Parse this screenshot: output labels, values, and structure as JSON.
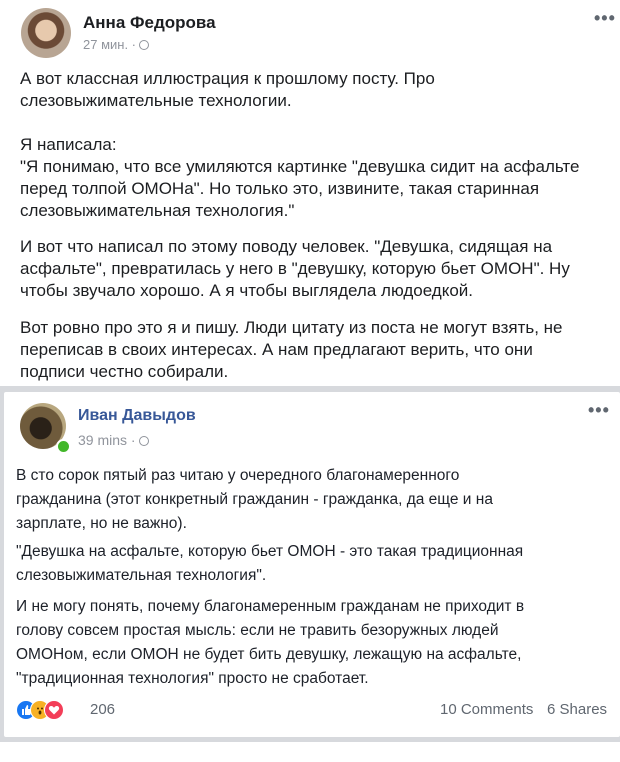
{
  "post1": {
    "author": "Анна Федорова",
    "time": "27 мин. ·",
    "lines": [
      "А вот классная иллюстрация к прошлому посту. Про",
      "слезовыжимательные технологии.",
      "Я написала:",
      "\"Я понимаю, что все умиляются картинке \"девушка сидит на асфальте",
      "перед толпой ОМОНа\". Но только это, извините, такая старинная",
      "слезовыжимательная технология.\"",
      "И вот что написал по этому поводу человек. \"Девушка, сидящая на",
      "асфальте\", превратилась у него в \"девушку, которую бьет ОМОН\". Ну",
      "чтобы звучало хорошо. А я чтобы выглядела людоедкой.",
      "Вот ровно про это я и пишу. Люди цитату из поста не могут взять, не",
      "переписав в своих интересах. А нам предлагают верить, что они",
      "подписи честно собирали."
    ]
  },
  "post2": {
    "author": "Иван Давыдов",
    "time": "39 mins ·",
    "lines": [
      "В сто сорок пятый раз читаю у очередного благонамеренного",
      "гражданина (этот конкретный гражданин - гражданка, да еще и на",
      "зарплате, но не важно).",
      "\"Девушка на асфальте, которую бьет ОМОН - это такая традиционная",
      "слезовыжимательная технология\".",
      "И не могу понять, почему благонамеренным гражданам не приходит в",
      "голову совсем простая мысль: если не травить безоружных людей",
      "ОМОНом, если ОМОН не будет бить девушку, лежащую на асфальте,",
      "\"традиционная технология\" просто не сработает."
    ],
    "reaction_count": "206",
    "comments": "10 Comments",
    "shares": "6 Shares",
    "reaction_icons": [
      "like-icon",
      "wow-icon",
      "love-icon"
    ]
  },
  "more_glyph": "•••",
  "colors": {
    "link_blue": "#385898",
    "like_blue": "#1877f2",
    "wow_yellow": "#f7b125",
    "love_red": "#f33e58"
  }
}
